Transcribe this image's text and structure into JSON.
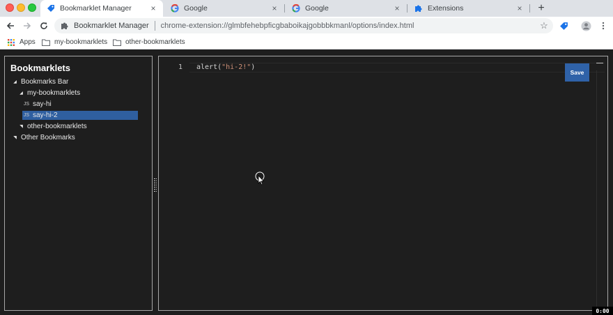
{
  "tabs": [
    {
      "label": "Bookmarklet Manager",
      "icon": "bookmark-tag-icon",
      "active": true
    },
    {
      "label": "Google",
      "icon": "google-g-icon",
      "active": false
    },
    {
      "label": "Google",
      "icon": "google-g-icon",
      "active": false
    },
    {
      "label": "Extensions",
      "icon": "puzzle-piece-icon",
      "active": false
    }
  ],
  "toolbar": {
    "site_name": "Bookmarklet Manager",
    "url": "chrome-extension://glmbfehebpficgbaboikajgobbbkmanl/options/index.html"
  },
  "bookmarks_bar": {
    "items": [
      {
        "label": "Apps",
        "icon": "apps-grid-icon"
      },
      {
        "label": "my-bookmarklets",
        "icon": "folder-icon"
      },
      {
        "label": "other-bookmarklets",
        "icon": "folder-icon"
      }
    ]
  },
  "sidebar": {
    "title": "Bookmarklets",
    "tree": [
      {
        "label": "Bookmarks Bar",
        "kind": "folder",
        "expanded": true,
        "level": 0
      },
      {
        "label": "my-bookmarklets",
        "kind": "folder",
        "expanded": true,
        "level": 1
      },
      {
        "label": "say-hi",
        "kind": "bookmarklet",
        "badge": "JS",
        "level": 2
      },
      {
        "label": "say-hi-2",
        "kind": "bookmarklet",
        "badge": "JS",
        "level": 2,
        "selected": true
      },
      {
        "label": "other-bookmarklets",
        "kind": "folder",
        "expanded": false,
        "level": 1
      },
      {
        "label": "Other Bookmarks",
        "kind": "folder",
        "expanded": false,
        "level": 0
      }
    ]
  },
  "editor": {
    "line_number": "1",
    "code_prefix": "alert(",
    "code_string": "\"hi-2!\"",
    "code_suffix": ")",
    "save_label": "Save"
  },
  "recording_timer": "0:00",
  "colors": {
    "accent": "#2f62a8",
    "selected_row": "#2f5fa0",
    "background": "#1e1e1e"
  }
}
